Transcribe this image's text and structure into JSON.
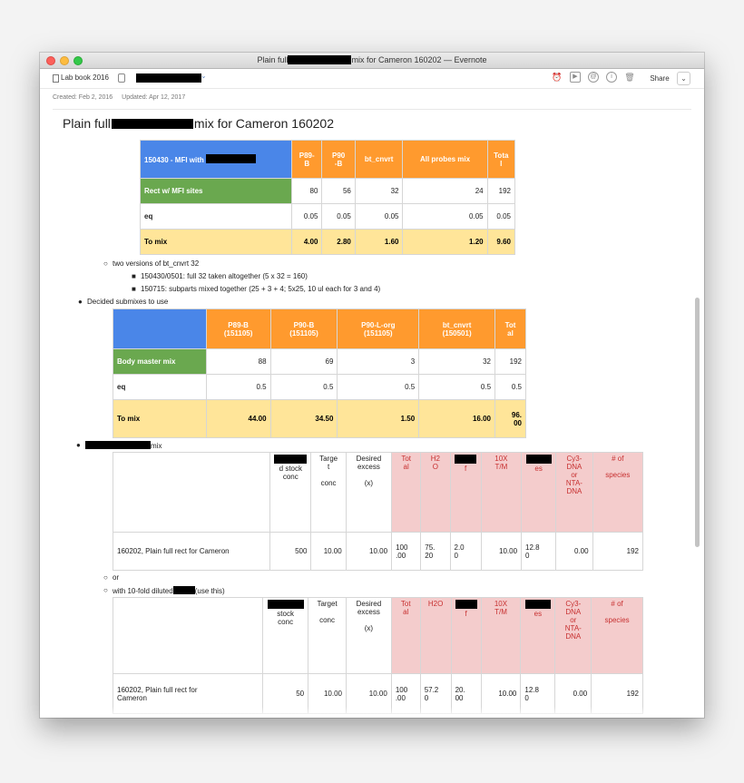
{
  "window": {
    "title_prefix": "Plain full",
    "title_suffix": "mix for Cameron 160202 — Evernote"
  },
  "toolbar": {
    "notebook": "Lab book 2016",
    "share_label": "Share",
    "icons": [
      "alarm-icon",
      "presentation-icon",
      "at-icon",
      "info-icon",
      "trash-icon"
    ]
  },
  "meta": {
    "created": "Created: Feb 2, 2016",
    "updated": "Updated: Apr 12, 2017"
  },
  "note": {
    "title_prefix": "Plain full",
    "title_suffix": "mix for Cameron 160202"
  },
  "table1": {
    "header": [
      "150430 - MFI with",
      "P89-\nB",
      "P90\n-B",
      "bt_cnvrt",
      "All probes mix",
      "Tota\nl"
    ],
    "rows": [
      [
        "Rect w/ MFI sites",
        "80",
        "56",
        "32",
        "24",
        "192"
      ],
      [
        "eq",
        "0.05",
        "0.05",
        "0.05",
        "0.05",
        "0.05"
      ],
      [
        "To mix",
        "4.00",
        "2.80",
        "1.60",
        "1.20",
        "9.60"
      ]
    ]
  },
  "bullets1": {
    "versions": "two versions of bt_cnvrt 32",
    "v1": "150430/0501: full 32 taken altogether (5 x 32 = 160)",
    "v2": "150715: subparts mixed together (25 + 3 + 4; 5x25, 10 ul each for 3 and 4)",
    "decided": "Decided submixes to use"
  },
  "table2": {
    "header": [
      "",
      "P89-B\n(151105)",
      "P90-B\n(151105)",
      "P90-L-org\n(151105)",
      "bt_cnvrt\n(150501)",
      "Tot\nal"
    ],
    "rows": [
      [
        "Body master mix",
        "88",
        "69",
        "3",
        "32",
        "192"
      ],
      [
        "eq",
        "0.5",
        "0.5",
        "0.5",
        "0.5",
        "0.5"
      ],
      [
        "To mix",
        "44.00",
        "34.50",
        "1.50",
        "16.00",
        "96.\n00"
      ]
    ]
  },
  "bullet_mix": "mix",
  "table3": {
    "header": [
      "",
      "d stock\nconc",
      "Targe\nt\n\nconc",
      "Desired\nexcess\n\n(x)",
      "Tot\nal",
      "H2\nO",
      "f",
      "10X\nT/M",
      "es",
      "Cy3-\nDNA\nor\nNTA-\nDNA",
      "# of\n\nspecies"
    ],
    "row": [
      "160202, Plain full rect for Cameron",
      "500",
      "10.00",
      "10.00",
      "100\n.00",
      "75.\n20",
      "2.0\n0",
      "10.00",
      "12.8\n0",
      "0.00",
      "192"
    ]
  },
  "bullets2": {
    "or": "or",
    "diluted_prefix": "with 10-fold diluted",
    "diluted_suffix": "(use this)"
  },
  "table4": {
    "header": [
      "",
      "stock\nconc",
      "Target\n\nconc",
      "Desired\nexcess\n\n(x)",
      "Tot\nal",
      "H2O",
      "f",
      "10X\nT/M",
      "es",
      "Cy3-\nDNA\nor\nNTA-\nDNA",
      "# of\n\nspecies"
    ],
    "row": [
      "160202, Plain full rect for\nCameron",
      "50",
      "10.00",
      "10.00",
      "100\n.00",
      "57.2\n0",
      "20.\n00",
      "10.00",
      "12.8\n0",
      "0.00",
      "192"
    ]
  },
  "colors": {
    "blue": "#4a86e8",
    "orange": "#ff9a2e",
    "green": "#6aa84f",
    "yellow": "#ffe599",
    "pink": "#f4cccc"
  }
}
